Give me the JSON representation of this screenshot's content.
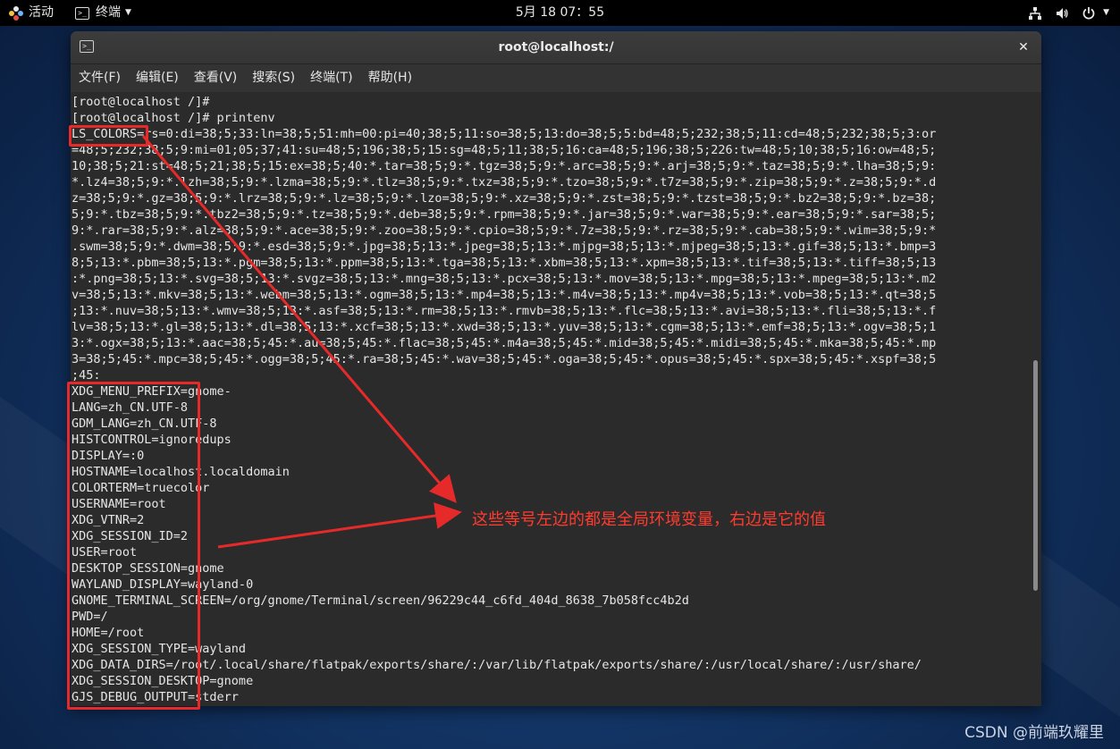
{
  "topbar": {
    "activities": "活动",
    "app_menu": "终端",
    "clock": "5月 18  07：55"
  },
  "window": {
    "title": "root@localhost:/",
    "close": "✕",
    "menu": [
      "文件(F)",
      "编辑(E)",
      "查看(V)",
      "搜索(S)",
      "终端(T)",
      "帮助(H)"
    ]
  },
  "terminal_lines": [
    "[root@localhost /]#",
    "[root@localhost /]# printenv",
    "LS_COLORS=rs=0:di=38;5;33:ln=38;5;51:mh=00:pi=40;38;5;11:so=38;5;13:do=38;5;5:bd=48;5;232;38;5;11:cd=48;5;232;38;5;3:or",
    "=48;5;232;38;5;9:mi=01;05;37;41:su=48;5;196;38;5;15:sg=48;5;11;38;5;16:ca=48;5;196;38;5;226:tw=48;5;10;38;5;16:ow=48;5;",
    "10;38;5;21:st=48;5;21;38;5;15:ex=38;5;40:*.tar=38;5;9:*.tgz=38;5;9:*.arc=38;5;9:*.arj=38;5;9:*.taz=38;5;9:*.lha=38;5;9:",
    "*.lz4=38;5;9:*.lzh=38;5;9:*.lzma=38;5;9:*.tlz=38;5;9:*.txz=38;5;9:*.tzo=38;5;9:*.t7z=38;5;9:*.zip=38;5;9:*.z=38;5;9:*.d",
    "z=38;5;9:*.gz=38;5;9:*.lrz=38;5;9:*.lz=38;5;9:*.lzo=38;5;9:*.xz=38;5;9:*.zst=38;5;9:*.tzst=38;5;9:*.bz2=38;5;9:*.bz=38;",
    "5;9:*.tbz=38;5;9:*.tbz2=38;5;9:*.tz=38;5;9:*.deb=38;5;9:*.rpm=38;5;9:*.jar=38;5;9:*.war=38;5;9:*.ear=38;5;9:*.sar=38;5;",
    "9:*.rar=38;5;9:*.alz=38;5;9:*.ace=38;5;9:*.zoo=38;5;9:*.cpio=38;5;9:*.7z=38;5;9:*.rz=38;5;9:*.cab=38;5;9:*.wim=38;5;9:*",
    ".swm=38;5;9:*.dwm=38;5;9:*.esd=38;5;9:*.jpg=38;5;13:*.jpeg=38;5;13:*.mjpg=38;5;13:*.mjpeg=38;5;13:*.gif=38;5;13:*.bmp=3",
    "8;5;13:*.pbm=38;5;13:*.pgm=38;5;13:*.ppm=38;5;13:*.tga=38;5;13:*.xbm=38;5;13:*.xpm=38;5;13:*.tif=38;5;13:*.tiff=38;5;13",
    ":*.png=38;5;13:*.svg=38;5;13:*.svgz=38;5;13:*.mng=38;5;13:*.pcx=38;5;13:*.mov=38;5;13:*.mpg=38;5;13:*.mpeg=38;5;13:*.m2",
    "v=38;5;13:*.mkv=38;5;13:*.webm=38;5;13:*.ogm=38;5;13:*.mp4=38;5;13:*.m4v=38;5;13:*.mp4v=38;5;13:*.vob=38;5;13:*.qt=38;5",
    ";13:*.nuv=38;5;13:*.wmv=38;5;13:*.asf=38;5;13:*.rm=38;5;13:*.rmvb=38;5;13:*.flc=38;5;13:*.avi=38;5;13:*.fli=38;5;13:*.f",
    "lv=38;5;13:*.gl=38;5;13:*.dl=38;5;13:*.xcf=38;5;13:*.xwd=38;5;13:*.yuv=38;5;13:*.cgm=38;5;13:*.emf=38;5;13:*.ogv=38;5;1",
    "3:*.ogx=38;5;13:*.aac=38;5;45:*.au=38;5;45:*.flac=38;5;45:*.m4a=38;5;45:*.mid=38;5;45:*.midi=38;5;45:*.mka=38;5;45:*.mp",
    "3=38;5;45:*.mpc=38;5;45:*.ogg=38;5;45:*.ra=38;5;45:*.wav=38;5;45:*.oga=38;5;45:*.opus=38;5;45:*.spx=38;5;45:*.xspf=38;5",
    ";45:",
    "XDG_MENU_PREFIX=gnome-",
    "LANG=zh_CN.UTF-8",
    "GDM_LANG=zh_CN.UTF-8",
    "HISTCONTROL=ignoredups",
    "DISPLAY=:0",
    "HOSTNAME=localhost.localdomain",
    "COLORTERM=truecolor",
    "USERNAME=root",
    "XDG_VTNR=2",
    "XDG_SESSION_ID=2",
    "USER=root",
    "DESKTOP_SESSION=gnome",
    "WAYLAND_DISPLAY=wayland-0",
    "GNOME_TERMINAL_SCREEN=/org/gnome/Terminal/screen/96229c44_c6fd_404d_8638_7b058fcc4b2d",
    "PWD=/",
    "HOME=/root",
    "XDG_SESSION_TYPE=wayland",
    "XDG_DATA_DIRS=/root/.local/share/flatpak/exports/share/:/var/lib/flatpak/exports/share/:/usr/local/share/:/usr/share/",
    "XDG_SESSION_DESKTOP=gnome",
    "GJS_DEBUG_OUTPUT=stderr"
  ],
  "annotation": {
    "text": "这些等号左边的都是全局环境变量，右边是它的值",
    "color": "#e62a2a"
  },
  "watermark": "CSDN @前端玖耀里"
}
